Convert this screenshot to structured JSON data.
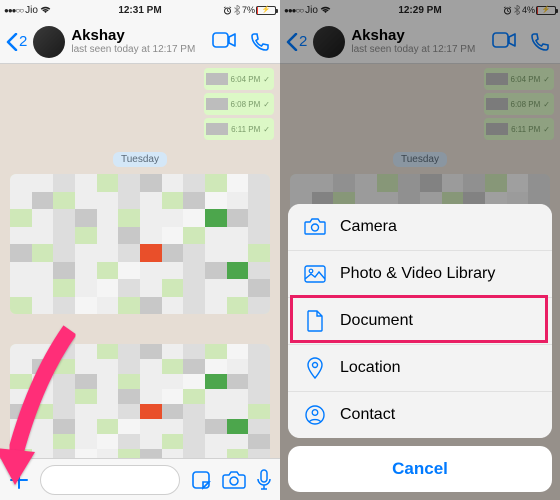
{
  "statusbar": {
    "carrier": "Jio",
    "wifi_icon": "wifi",
    "lock_icon": "lock",
    "alarm_icon": "alarm",
    "bt_icon": "bluetooth"
  },
  "left": {
    "time": "12:31 PM",
    "battery_pct": "7%",
    "back_count": "2",
    "contact_name": "Akshay",
    "last_seen": "last seen today at 12:17 PM",
    "bubbles": [
      {
        "time": "6:04 PM"
      },
      {
        "time": "6:08 PM"
      },
      {
        "time": "6:11 PM"
      }
    ],
    "day_label": "Tuesday"
  },
  "right": {
    "time": "12:29 PM",
    "battery_pct": "4%",
    "back_count": "2",
    "contact_name": "Akshay",
    "last_seen": "last seen today at 12:17 PM",
    "bubbles": [
      {
        "time": "6:04 PM"
      },
      {
        "time": "6:08 PM"
      },
      {
        "time": "6:11 PM"
      }
    ],
    "day_label": "Tuesday",
    "sheet": {
      "camera": "Camera",
      "photo": "Photo & Video Library",
      "document": "Document",
      "location": "Location",
      "contact": "Contact",
      "cancel": "Cancel"
    }
  }
}
